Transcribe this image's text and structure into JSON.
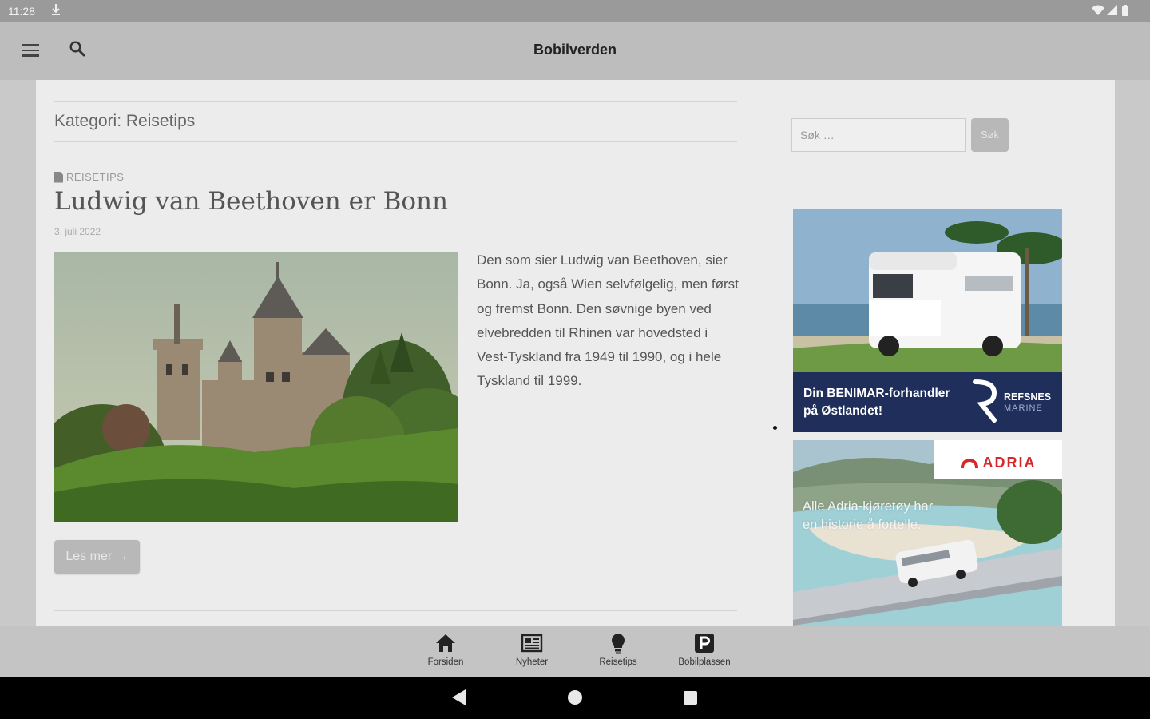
{
  "status_bar": {
    "time": "11:28",
    "notification_icon": "download-arrow-icon",
    "system_icons": [
      "wifi-icon",
      "signal-icon",
      "battery-icon"
    ]
  },
  "app_bar": {
    "title": "Bobilverden",
    "menu_icon": "hamburger-menu-icon",
    "search_icon": "search-icon"
  },
  "main": {
    "archive_heading": "Kategori: Reisetips",
    "post": {
      "category": "REISETIPS",
      "title": "Ludwig van Beethoven er Bonn",
      "date": "3. juli 2022",
      "image_alt": "Castle on a forested hill",
      "excerpt": "Den som sier Ludwig van Beethoven, sier Bonn. Ja, også Wien selvfølgelig, men først og fremst Bonn. Den søvnige byen ved elvebredden til Rhinen var hovedsted i Vest-Tyskland fra 1949 til 1990, og i hele Tyskland til 1999.",
      "read_more": "Les mer →"
    }
  },
  "sidebar": {
    "search_placeholder": "Søk …",
    "search_button": "Søk",
    "ad_benimar": {
      "text_line1": "Din BENIMAR-forhandler",
      "text_line2": "på Østlandet!",
      "brand": "REFSNES",
      "brand_sub": "MARINE"
    },
    "ad_adria": {
      "brand": "ADRIA",
      "slogan_line1": "Alle Adria-kjøretøy har",
      "slogan_line2": "en historie å fortelle."
    }
  },
  "bottom_nav": {
    "items": [
      {
        "label": "Forsiden",
        "icon": "home-icon"
      },
      {
        "label": "Nyheter",
        "icon": "newspaper-icon"
      },
      {
        "label": "Reisetips",
        "icon": "lightbulb-icon"
      },
      {
        "label": "Bobilplassen",
        "icon": "parking-icon"
      }
    ]
  },
  "colors": {
    "status_bar": "#9a9a9a",
    "app_bar": "#bdbdbd",
    "content_bg": "#ececec",
    "ad_banner": "#1f2e5a",
    "adria_red": "#d6272a"
  }
}
